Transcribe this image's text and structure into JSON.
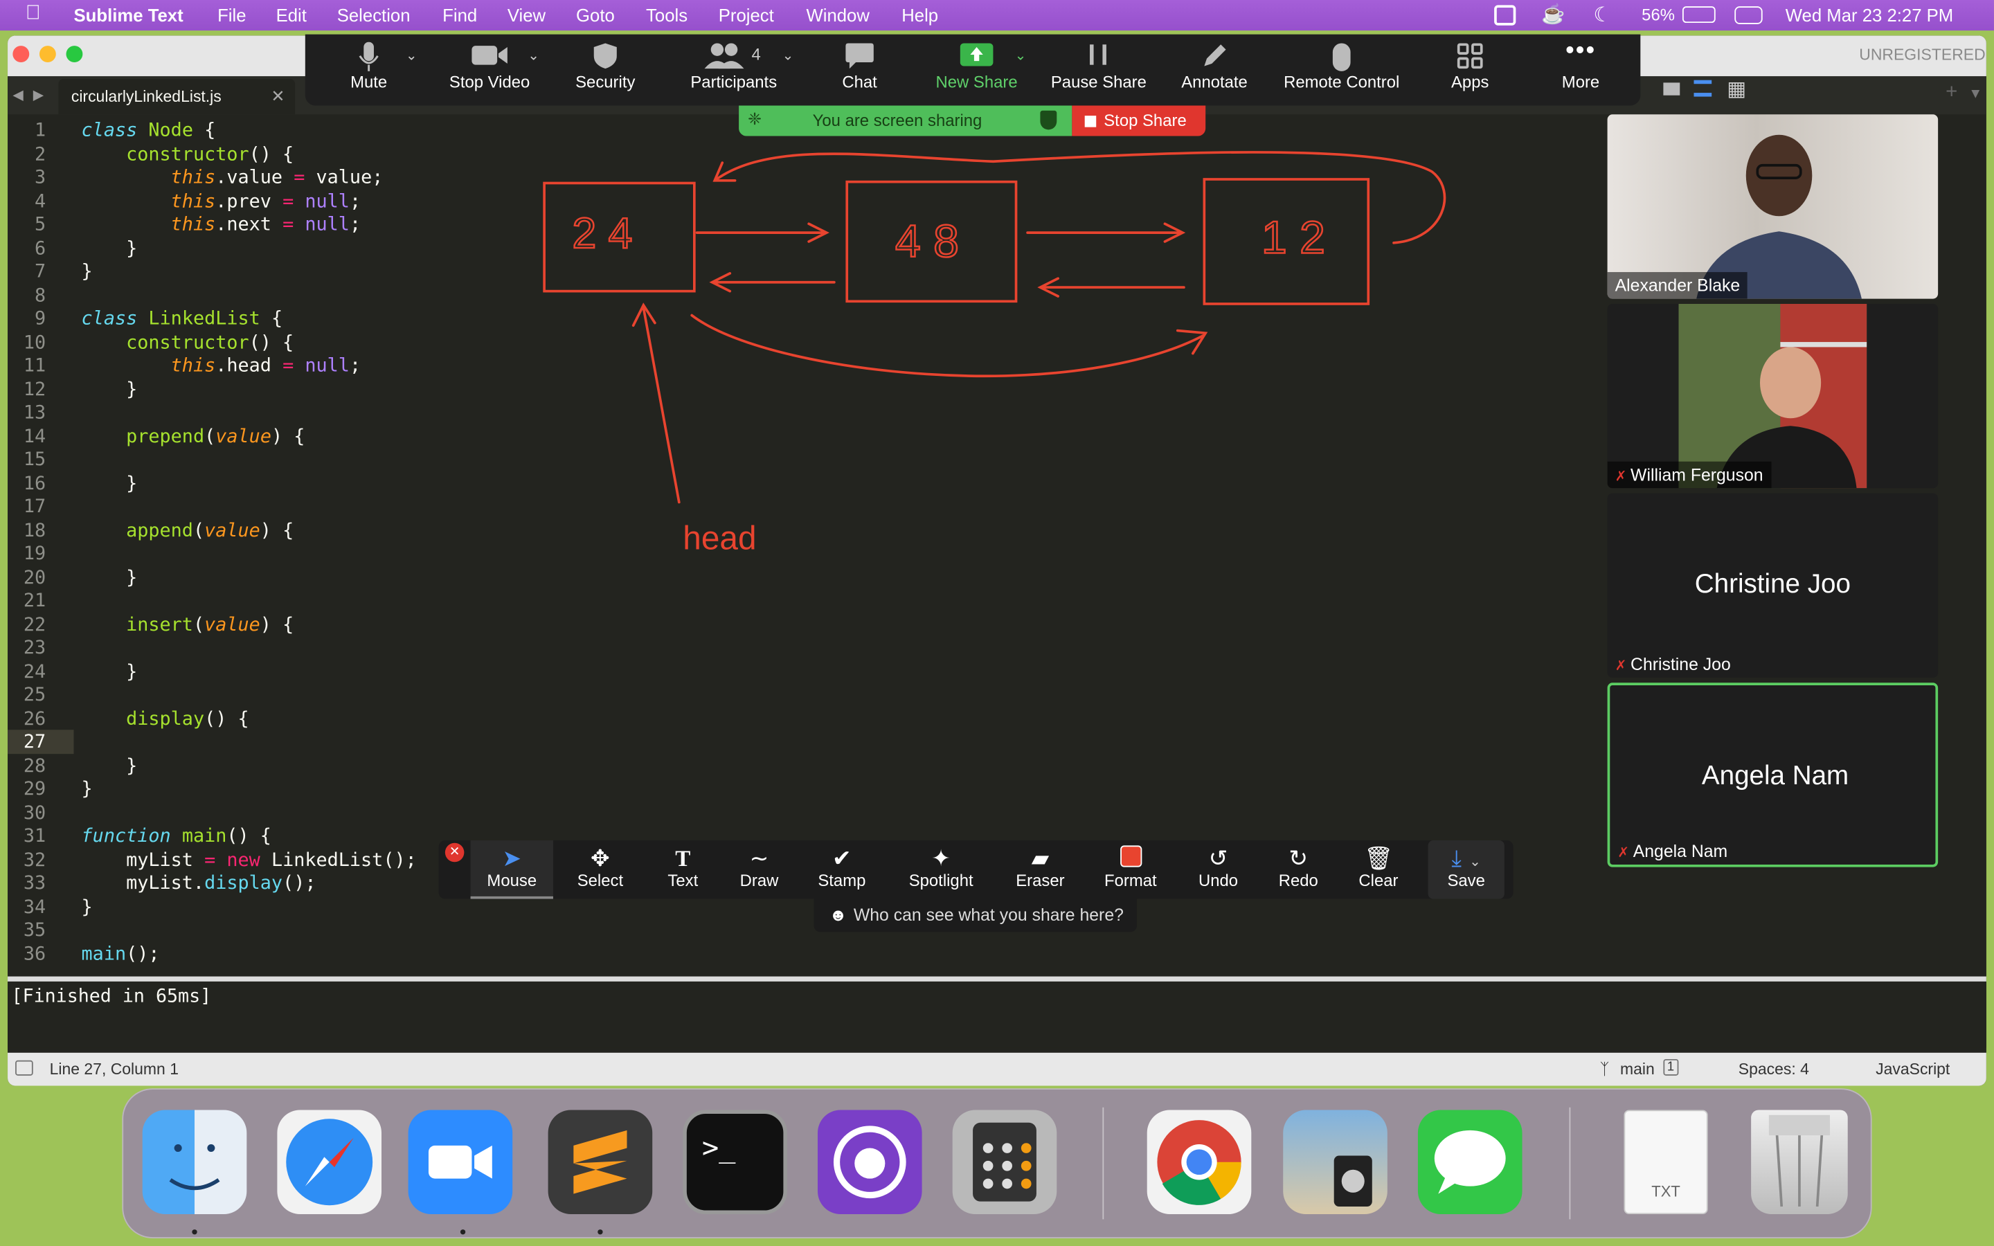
{
  "menubar": {
    "app": "Sublime Text",
    "items": [
      "File",
      "Edit",
      "Selection",
      "Find",
      "View",
      "Goto",
      "Tools",
      "Project",
      "Window",
      "Help"
    ],
    "battery": "56%",
    "datetime": "Wed Mar 23  2:27 PM"
  },
  "window": {
    "unregistered": "UNREGISTERED",
    "tab_name": "circularlyLinkedList.js",
    "current_line": 27
  },
  "code_lines": [
    "1",
    "2",
    "3",
    "4",
    "5",
    "6",
    "7",
    "8",
    "9",
    "10",
    "11",
    "12",
    "13",
    "14",
    "15",
    "16",
    "17",
    "18",
    "19",
    "20",
    "21",
    "22",
    "23",
    "24",
    "25",
    "26",
    "27",
    "28",
    "29",
    "30",
    "31",
    "32",
    "33",
    "34",
    "35",
    "36"
  ],
  "output": "[Finished in 65ms]",
  "statusbar": {
    "position": "Line 27, Column 1",
    "branch": "main",
    "branch_count": "1",
    "spaces": "Spaces: 4",
    "syntax": "JavaScript"
  },
  "zoom_toolbar": {
    "mute": "Mute",
    "stop_video": "Stop Video",
    "security": "Security",
    "participants": "Participants",
    "participants_count": "4",
    "chat": "Chat",
    "new_share": "New Share",
    "pause_share": "Pause Share",
    "annotate": "Annotate",
    "remote_control": "Remote Control",
    "apps": "Apps",
    "more": "More"
  },
  "share_banner": {
    "text": "You are screen sharing",
    "stop": "Stop Share"
  },
  "drawing": {
    "nodes": [
      "2 4",
      "4 8",
      "1 2"
    ],
    "head_label": "head",
    "color": "#e8442f"
  },
  "participants": [
    {
      "name": "Alexander Blake",
      "video": true,
      "muted": false
    },
    {
      "name": "William Ferguson",
      "video": true,
      "muted": true
    },
    {
      "name": "Christine Joo",
      "video": false,
      "muted": true
    },
    {
      "name": "Angela Nam",
      "video": false,
      "muted": true,
      "active_speaker": true
    }
  ],
  "annotation_toolbar": {
    "mouse": "Mouse",
    "select": "Select",
    "text": "Text",
    "draw": "Draw",
    "stamp": "Stamp",
    "spotlight": "Spotlight",
    "eraser": "Eraser",
    "format": "Format",
    "undo": "Undo",
    "redo": "Redo",
    "clear": "Clear",
    "save": "Save",
    "who_can_see": "Who can see what you share here?"
  },
  "dock": {
    "txt_label": "TXT",
    "apps": [
      "finder",
      "safari",
      "zoom",
      "sublime-text",
      "terminal",
      "github-desktop",
      "calculator",
      "chrome",
      "preview",
      "messages",
      "txt-file",
      "trash"
    ]
  }
}
